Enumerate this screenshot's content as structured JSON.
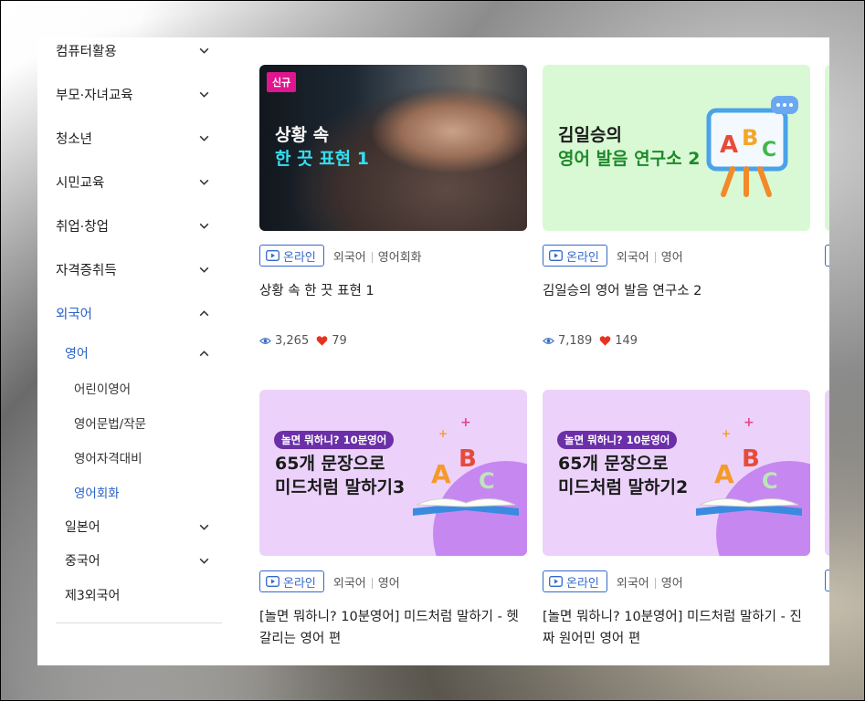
{
  "sidebar": {
    "items": [
      {
        "label": "컴퓨터활용"
      },
      {
        "label": "부모·자녀교육"
      },
      {
        "label": "청소년"
      },
      {
        "label": "시민교육"
      },
      {
        "label": "취업·창업"
      },
      {
        "label": "자격증취득"
      },
      {
        "label": "외국어"
      }
    ],
    "sub": [
      {
        "label": "영어"
      },
      {
        "label": "일본어"
      },
      {
        "label": "중국어"
      },
      {
        "label": "제3외국어"
      }
    ],
    "english_sub": [
      {
        "label": "어린이영어"
      },
      {
        "label": "영어문법/작문"
      },
      {
        "label": "영어자격대비"
      },
      {
        "label": "영어회화"
      }
    ]
  },
  "cards": [
    {
      "badge": "신규",
      "thumb_line1": "상황 속",
      "thumb_line2": "한 끗 표현 1",
      "mode": "온라인",
      "cat1": "외국어",
      "cat2": "영어회화",
      "title": "상황 속 한 끗 표현 1",
      "views": "3,265",
      "likes": "79"
    },
    {
      "thumb_line1": "김일승의",
      "thumb_line2": "영어 발음 연구소 2",
      "mode": "온라인",
      "cat1": "외국어",
      "cat2": "영어",
      "title": "김일승의 영어 발음 연구소 2",
      "views": "7,189",
      "likes": "149"
    },
    {
      "tag": "놀면 뭐하니? 10분영어",
      "thumb_line1": "65개 문장으로",
      "thumb_line2": "미드처럼 말하기3",
      "mode": "온라인",
      "cat1": "외국어",
      "cat2": "영어",
      "title_line1": "[놀면 뭐하니? 10분영어] 미드처럼 말하기 - 헷",
      "title_line2": "갈리는 영어 편"
    },
    {
      "tag": "놀면 뭐하니? 10분영어",
      "thumb_line1": "65개 문장으로",
      "thumb_line2": "미드처럼 말하기2",
      "mode": "온라인",
      "cat1": "외국어",
      "cat2": "영어",
      "title_line1": "[놀면 뭐하니? 10분영어] 미드처럼 말하기 - 진",
      "title_line2": "짜 원어민 영어 편"
    }
  ],
  "colors": {
    "accent": "#2a63c7",
    "heart": "#e8321e",
    "badge": "#e0158f"
  }
}
